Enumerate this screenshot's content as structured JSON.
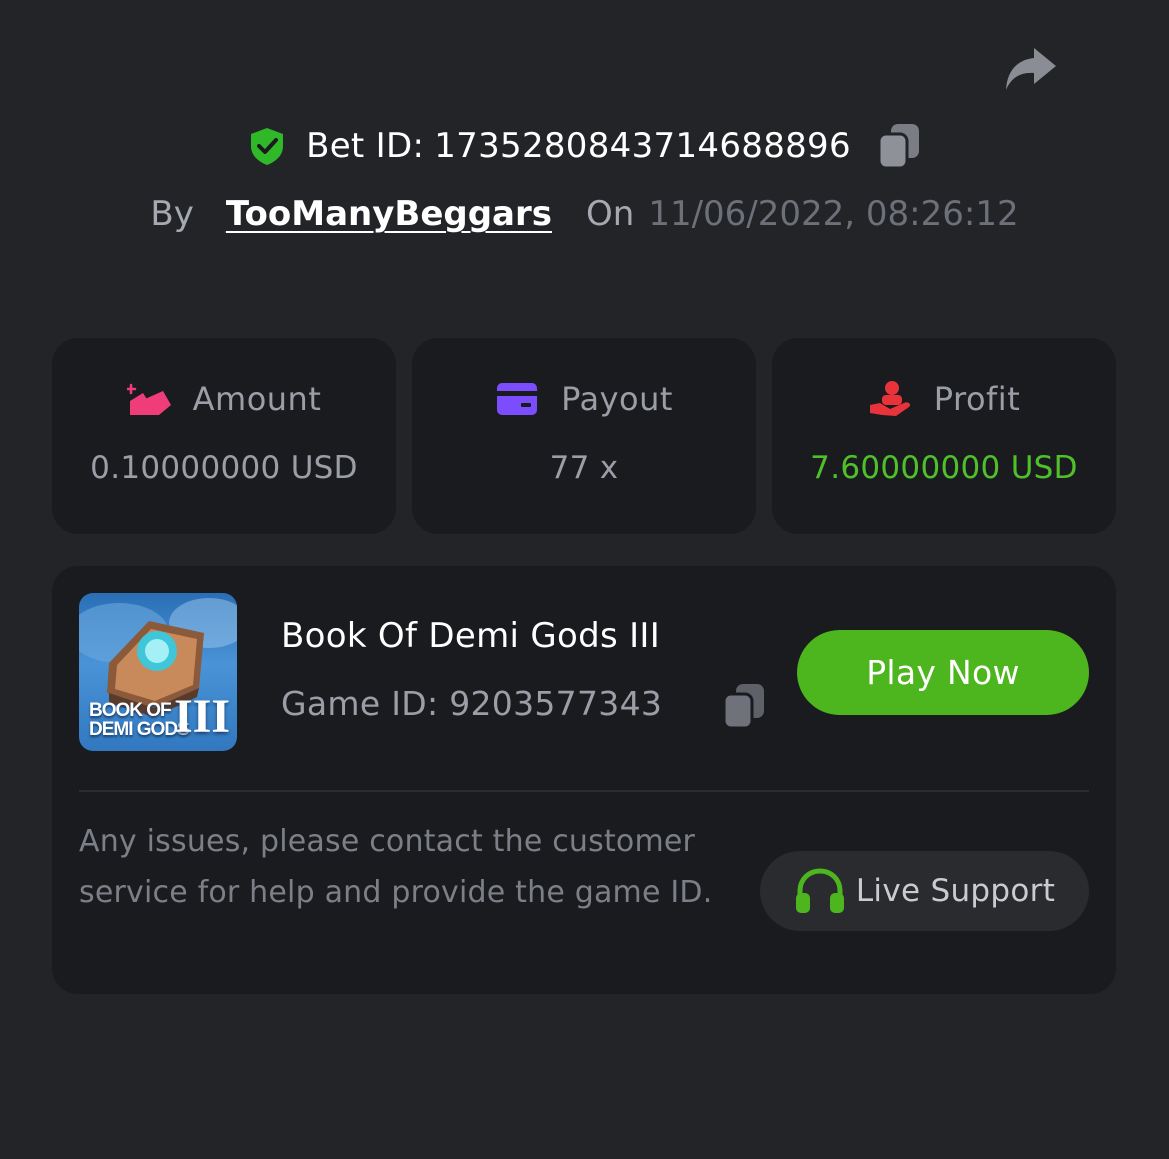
{
  "header": {
    "share_icon": "share-arrow-icon",
    "bet_id_label": "Bet ID:",
    "bet_id": "1735280843714688896",
    "by_label": "By",
    "username": "TooManyBeggars",
    "on_label": "On",
    "datetime": "11/06/2022, 08:26:12"
  },
  "stats": [
    {
      "label": "Amount",
      "value": "0.10000000 USD",
      "icon": "bet-amount-icon",
      "icon_color": "#ef3d7a"
    },
    {
      "label": "Payout",
      "value": "77 x",
      "icon": "card-icon",
      "icon_color": "#7c4dff"
    },
    {
      "label": "Profit",
      "value": "7.60000000 USD",
      "icon": "hand-coin-icon",
      "icon_color": "#e8333a",
      "value_color": "#4fc02a"
    }
  ],
  "game": {
    "thumb_text_line1": "BOOK OF",
    "thumb_text_line2": "DEMI GODS",
    "thumb_roman": "III",
    "title": "Book Of Demi Gods III",
    "game_id_label": "Game ID:",
    "game_id": "9203577343",
    "play_label": "Play Now",
    "help_text": "Any issues, please contact the customer service for help and provide the game ID.",
    "support_label": "Live Support",
    "support_icon_color": "#4db51d"
  },
  "colors": {
    "background": "#232427",
    "card": "#1a1b1e",
    "accent_green": "#4db51d",
    "shield_green": "#2fb928"
  }
}
